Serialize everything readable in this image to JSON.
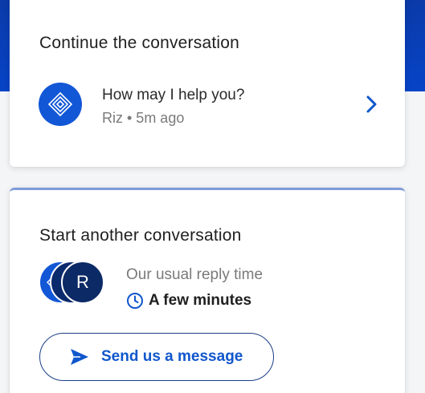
{
  "colors": {
    "brand_blue": "#1257d6",
    "header_blue": "#0644c7",
    "dark_navy": "#0c2a66",
    "accent_link": "#1057cc",
    "text_dark": "#1f1f1f",
    "text_muted": "#7a7a7a"
  },
  "continue_card": {
    "title": "Continue the conversation",
    "conversation": {
      "avatar_icon": "bot-logo-icon",
      "message": "How may I help you?",
      "meta": "Riz • 5m ago",
      "chevron_icon": "chevron-right-icon"
    }
  },
  "start_card": {
    "title": "Start another conversation",
    "avatars": [
      {
        "icon": "bot-logo-icon"
      },
      {
        "icon": "team-avatar"
      },
      {
        "initial": "R"
      }
    ],
    "reply_label": "Our usual reply time",
    "reply_time_icon": "clock-icon",
    "reply_time": "A few minutes",
    "send_button": {
      "icon": "send-icon",
      "label": "Send us a message"
    }
  }
}
